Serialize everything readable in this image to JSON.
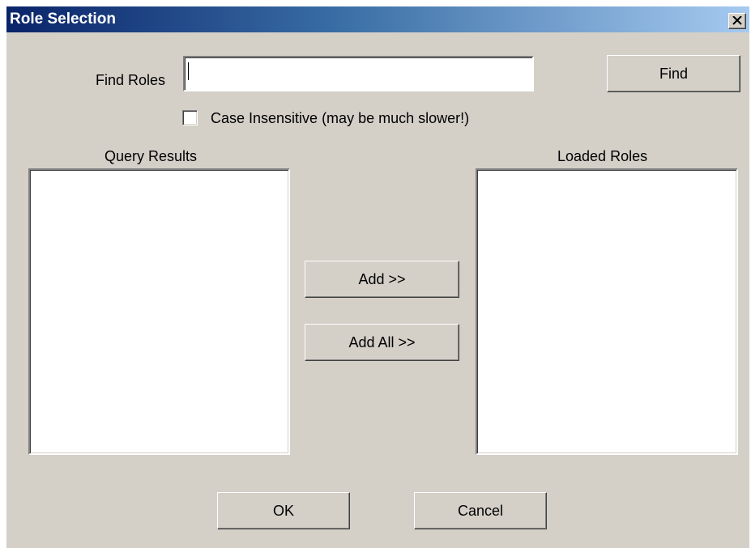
{
  "window": {
    "title": "Role Selection"
  },
  "search": {
    "label": "Find Roles",
    "value": "",
    "find_button": "Find"
  },
  "options": {
    "case_insensitive_label": "Case Insensitive (may be much slower!)",
    "case_insensitive_checked": false
  },
  "query_results": {
    "label": "Query Results",
    "items": []
  },
  "loaded_roles": {
    "label": "Loaded Roles",
    "items": []
  },
  "transfer": {
    "add_label": "Add >>",
    "add_all_label": "Add  All >>"
  },
  "footer": {
    "ok_label": "OK",
    "cancel_label": "Cancel"
  },
  "colors": {
    "dialog_background": "#d4d0c8",
    "titlebar_start": "#0a246a",
    "titlebar_end": "#a6caf0",
    "title_text": "#ffffff"
  }
}
